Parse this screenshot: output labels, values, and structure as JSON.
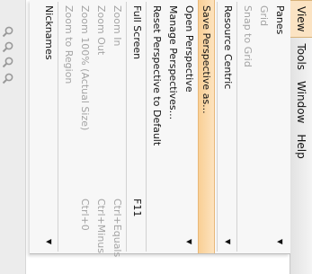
{
  "menubar": {
    "items": [
      {
        "label": "View",
        "active": true
      },
      {
        "label": "Tools"
      },
      {
        "label": "Window"
      },
      {
        "label": "Help"
      }
    ]
  },
  "menu": {
    "items": [
      {
        "label": "Panes",
        "submenu": true,
        "disabled": false
      },
      {
        "label": "Grid",
        "disabled": true
      },
      {
        "label": "Snap to Grid",
        "disabled": true
      },
      {
        "separator": true
      },
      {
        "label": "Resource Centric",
        "submenu": true,
        "disabled": false
      },
      {
        "separator": true
      },
      {
        "label": "Save Perspective as...",
        "highlighted": true
      },
      {
        "label": "Open Perspective",
        "submenu": true
      },
      {
        "label": "Manage Perspectives..."
      },
      {
        "label": "Reset Perspective to Default"
      },
      {
        "separator": true
      },
      {
        "label": "Full Screen",
        "shortcut": "F11"
      },
      {
        "separator": true
      },
      {
        "label": "Zoom In",
        "shortcut": "Ctrl+Equals",
        "disabled": true
      },
      {
        "label": "Zoom Out",
        "shortcut": "Ctrl+Minus",
        "disabled": true
      },
      {
        "label": "Zoom 100% (Actual Size)",
        "shortcut": "Ctrl+0",
        "disabled": true
      },
      {
        "label": "Zoom to Region",
        "disabled": true
      },
      {
        "separator": true
      },
      {
        "label": "Nicknames",
        "submenu": true
      }
    ]
  },
  "toolbar": {
    "icons": [
      "search-icon",
      "search-icon",
      "search-icon",
      "search-icon"
    ]
  },
  "colors": {
    "highlight": "#f9cf95",
    "menu_bg": "#f7f7f7",
    "disabled_text": "#a4a4a4"
  }
}
